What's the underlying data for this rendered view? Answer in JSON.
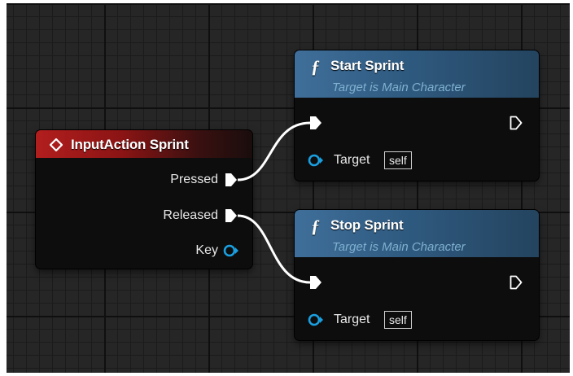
{
  "event_node": {
    "title": "InputAction Sprint",
    "icon": "diamond-event-icon",
    "pins": {
      "pressed": "Pressed",
      "released": "Released",
      "key": "Key"
    }
  },
  "start_node": {
    "title": "Start Sprint",
    "subtitle": "Target is Main Character",
    "icon": "function-icon",
    "target_label": "Target",
    "target_value": "self"
  },
  "stop_node": {
    "title": "Stop Sprint",
    "subtitle": "Target is Main Character",
    "icon": "function-icon",
    "target_label": "Target",
    "target_value": "self"
  },
  "colors": {
    "event_header": "#b21e1e",
    "function_header": "#3f6f9a",
    "object_pin": "#1a9fe0",
    "exec_pin": "#ffffff",
    "background": "#262626"
  }
}
